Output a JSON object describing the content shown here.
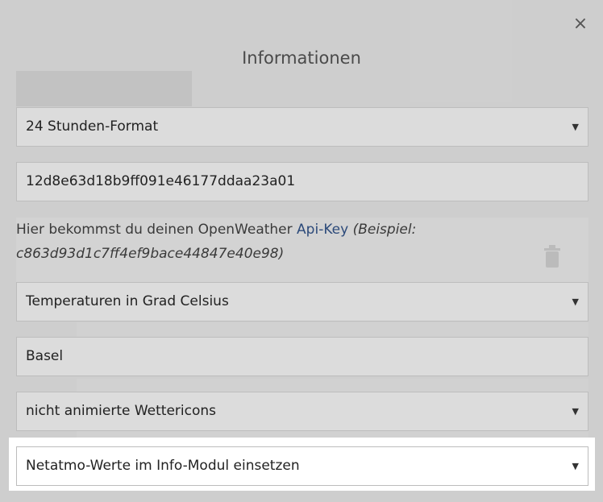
{
  "modal": {
    "title": "Informationen",
    "close_glyph": "×"
  },
  "fields": {
    "time_format": {
      "value": "24 Stunden-Format"
    },
    "api_key": {
      "value": "12d8e63d18b9ff091e46177ddaa23a01"
    },
    "helper": {
      "prefix": "Hier bekommst du deinen OpenWeather ",
      "link": "Api-Key",
      "example": "(Beispiel: c863d93d1c7ff4ef9bace44847e40e98)"
    },
    "temperature_unit": {
      "value": "Temperaturen in Grad Celsius"
    },
    "city": {
      "value": "Basel"
    },
    "weather_icons": {
      "value": "nicht animierte Wettericons"
    },
    "netatmo": {
      "value": "Netatmo-Werte im Info-Modul einsetzen"
    }
  },
  "caret_glyph": "▼",
  "icons": {
    "close": "close-icon",
    "caret": "chevron-down-icon",
    "trash": "trash-icon"
  },
  "colors": {
    "link": "#2c4a7a",
    "highlight": "#ffffff"
  }
}
